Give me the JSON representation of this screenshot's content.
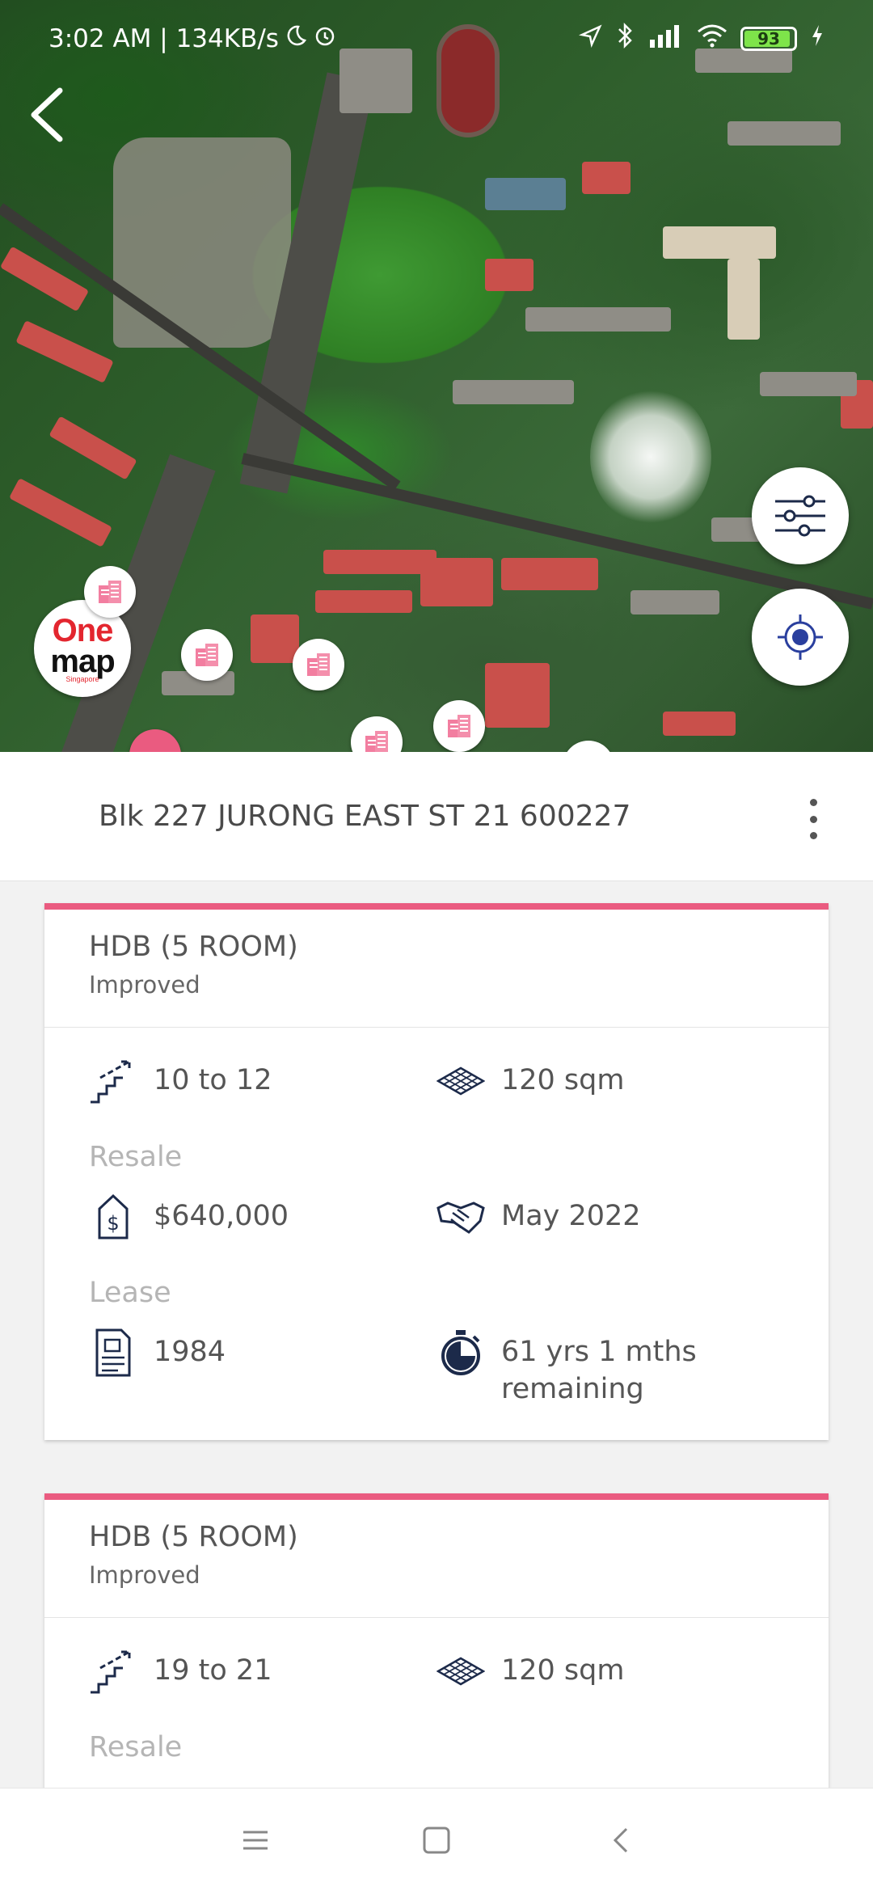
{
  "status_bar": {
    "time_and_speed": "3:02 AM | 134KB/s",
    "battery_level": "93"
  },
  "map": {
    "logo_text_one": "One",
    "logo_text_map": "map",
    "logo_text_country": "Singapore",
    "icons": [
      "back-arrow-icon",
      "filter-sliders-icon",
      "my-location-icon",
      "hdb-building-marker-icon"
    ]
  },
  "address": {
    "text": "Blk 227 JURONG EAST ST 21 600227"
  },
  "cards": [
    {
      "title": "HDB (5 ROOM)",
      "subtitle": "Improved",
      "storey": "10 to 12",
      "area": "120 sqm",
      "resale_label": "Resale",
      "price": "$640,000",
      "date": "May 2022",
      "lease_label": "Lease",
      "lease_year": "1984",
      "remaining_line1": "61 yrs 1 mths",
      "remaining_line2": "remaining"
    },
    {
      "title": "HDB (5 ROOM)",
      "subtitle": "Improved",
      "storey": "19 to 21",
      "area": "120 sqm",
      "resale_label": "Resale"
    }
  ],
  "colors": {
    "accent_pink": "#ea5b80",
    "icon_navy": "#1c2a4a",
    "locate_blue": "#2a3f9e"
  }
}
